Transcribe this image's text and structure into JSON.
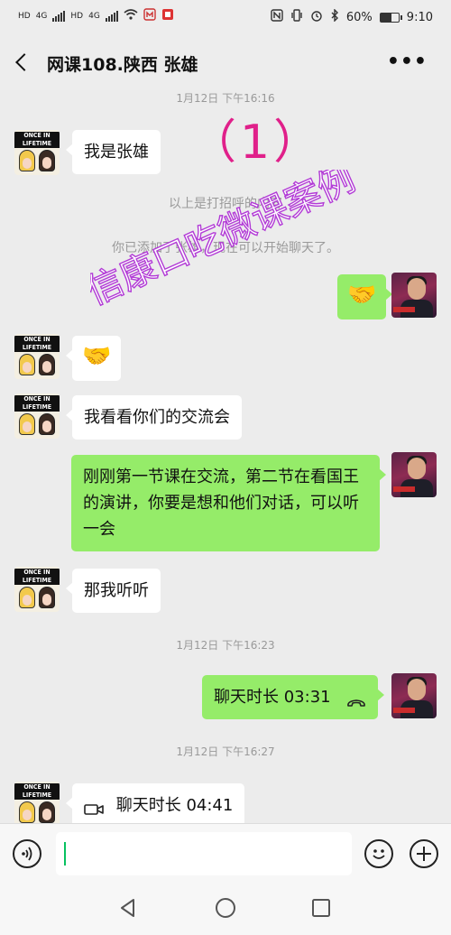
{
  "status_bar": {
    "left_carrier": [
      "HD",
      "4G",
      "HD",
      "4G"
    ],
    "battery_percent": "60%",
    "battery_level": 0.6,
    "time": "9:10"
  },
  "header": {
    "title": "网课108.陕西 张雄",
    "back_icon": "chevron-left-icon",
    "more_label": "•••"
  },
  "overlay": {
    "number": "（1）",
    "watermark": "信康口吃微课案例"
  },
  "messages": {
    "time1": "1月12日 下午16:16",
    "m1": "我是张雄",
    "sys1": "以上是打招呼的内容",
    "sys2": "你已添加了张雄，现在可以开始聊天了。",
    "m2_emoji": "🤝",
    "m3_emoji": "🤝",
    "m4": "我看看你们的交流会",
    "m5": "刚刚第一节课在交流，第二节在看国王的演讲，你要是想和他们对话，可以听一会",
    "m6": "那我听听",
    "time2": "1月12日 下午16:23",
    "m7": "聊天时长 03:31",
    "time3": "1月12日 下午16:27",
    "m8": "聊天时长 04:41"
  },
  "avatars": {
    "contact_banner": "ONCE IN LIFETIME"
  },
  "input_bar": {
    "placeholder": "",
    "voice_icon": "voice-icon",
    "emoji_icon": "emoji-icon",
    "plus_icon": "plus-icon"
  },
  "colors": {
    "out_bubble": "#95ec69",
    "in_bubble": "#ffffff",
    "overlay_number": "#e0208a",
    "watermark": "#b23bd6"
  }
}
